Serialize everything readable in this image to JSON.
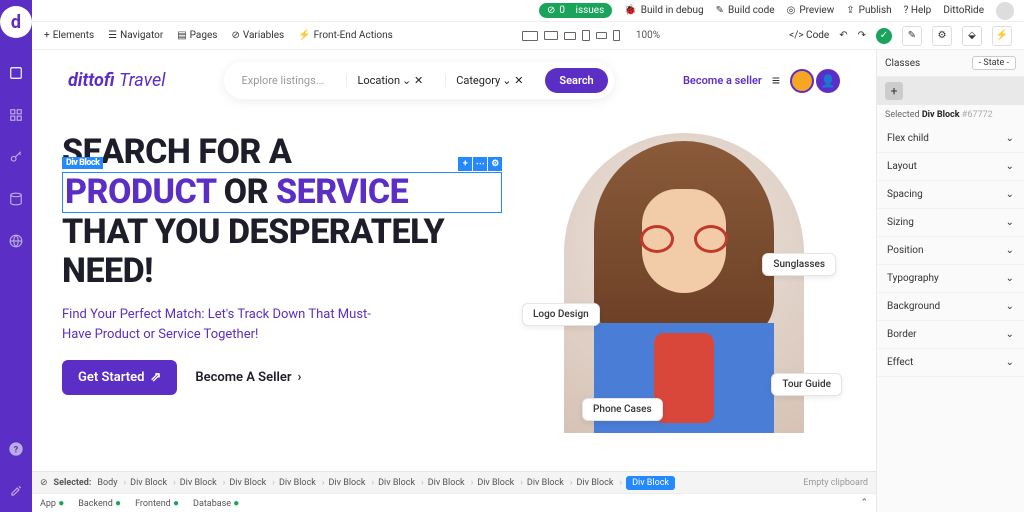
{
  "top": {
    "issues_count": 0,
    "issues_label": "issues",
    "build_debug": "Build in debug",
    "build_code": "Build code",
    "preview": "Preview",
    "publish": "Publish",
    "help": "? Help",
    "product": "DittoRide"
  },
  "toolbar": {
    "elements": "Elements",
    "navigator": "Navigator",
    "pages": "Pages",
    "variables": "Variables",
    "frontend": "Front-End Actions",
    "zoom": "100%",
    "code": "</> Code"
  },
  "site": {
    "brand1": "dittofi",
    "brand2": "Travel",
    "search_placeholder": "Explore listings...",
    "filter_location": "Location",
    "filter_category": "Category",
    "search_btn": "Search",
    "become_seller": "Become a seller"
  },
  "hero": {
    "line1": "SEARCH FOR A",
    "product": "PRODUCT",
    "or": "OR",
    "service": "SERVICE",
    "line3a": "THAT YOU DESPERATELY",
    "line3b": "NEED!",
    "sub": "Find Your Perfect Match: Let's Track Down That Must-Have Product or Service Together!",
    "cta1": "Get Started",
    "cta2": "Become A Seller",
    "float1": "Sunglasses",
    "float2": "Logo Design",
    "float3": "Tour Guide",
    "float4": "Phone Cases"
  },
  "selection": {
    "label": "Div Block"
  },
  "panel": {
    "classes": "Classes",
    "state": "- State -",
    "selected_prefix": "Selected",
    "selected_el": "Div Block",
    "selected_id": "#67772",
    "sections": [
      "Flex child",
      "Layout",
      "Spacing",
      "Sizing",
      "Position",
      "Typography",
      "Background",
      "Border",
      "Effect"
    ]
  },
  "crumbs": {
    "selected_label": "Selected:",
    "path": [
      "Body",
      "Div Block",
      "Div Block",
      "Div Block",
      "Div Block",
      "Div Block",
      "Div Block",
      "Div Block",
      "Div Block",
      "Div Block",
      "Div Block",
      "Div Block"
    ],
    "clipboard": "Empty clipboard"
  },
  "status": {
    "app": "App",
    "backend": "Backend",
    "frontend": "Frontend",
    "database": "Database"
  }
}
